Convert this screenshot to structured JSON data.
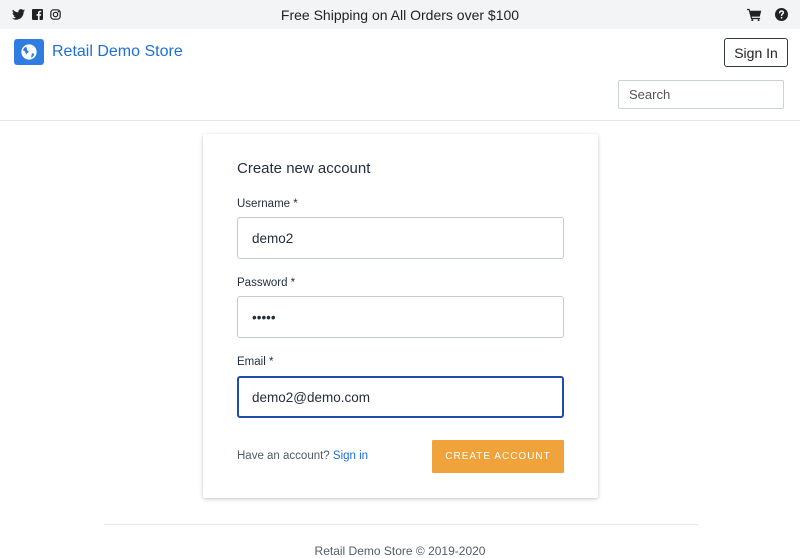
{
  "topbar": {
    "promo": "Free Shipping on All Orders over $100",
    "social_icons": [
      "twitter-icon",
      "facebook-icon",
      "instagram-icon"
    ],
    "right_icons": [
      "cart-icon",
      "help-icon"
    ]
  },
  "header": {
    "brand_name": "Retail Demo Store",
    "brand_icon": "globe-icon",
    "signin_label": "Sign In",
    "search": {
      "placeholder": "Search",
      "value": ""
    }
  },
  "signup": {
    "title": "Create new account",
    "fields": [
      {
        "label": "Username *",
        "value": "demo2",
        "type": "text"
      },
      {
        "label": "Password *",
        "value": "demo2",
        "type": "password"
      },
      {
        "label": "Email *",
        "value": "demo2@demo.com",
        "type": "email",
        "focused": true
      }
    ],
    "have_account_text": "Have an account?",
    "signin_link": "Sign in",
    "create_button": "CREATE ACCOUNT"
  },
  "footer": {
    "text": "Retail Demo Store © 2019-2020"
  },
  "colors": {
    "brand_blue": "#1d6fd8",
    "accent_orange": "#f0a33a",
    "focus_border": "#1f4ea8",
    "topbar_bg": "#f3f4f6"
  }
}
